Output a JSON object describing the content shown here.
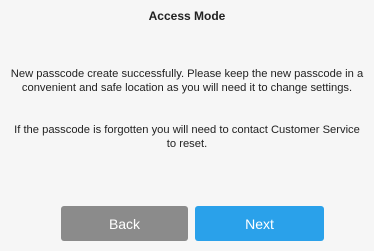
{
  "dialog": {
    "title": "Access Mode",
    "message_success": "New passcode create successfully. Please keep the new passcode in a convenient and safe location as you will need it to change settings.",
    "message_forgotten": "If the passcode is forgotten you will need to contact Customer Service to reset.",
    "buttons": {
      "back_label": "Back",
      "next_label": "Next"
    }
  },
  "colors": {
    "background": "#f6f6f6",
    "back_button": "#8b8b8b",
    "next_button": "#2aa1ea",
    "button_text": "#ffffff"
  }
}
